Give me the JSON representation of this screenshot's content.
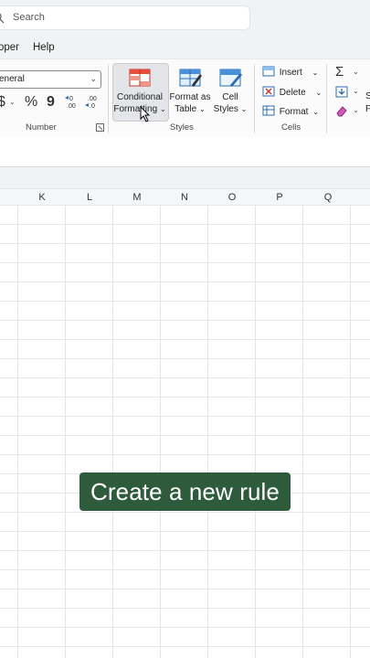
{
  "search": {
    "placeholder": "Search"
  },
  "menu": {
    "tabs": [
      "oper",
      "Help"
    ]
  },
  "number_group": {
    "format_value": "eneral",
    "label": "Number",
    "currency_symbol": "$",
    "percent_symbol": "%",
    "comma_symbol": "9"
  },
  "styles_group": {
    "label": "Styles",
    "conditional_formatting": [
      "Conditional",
      "Formatting"
    ],
    "format_as_table": [
      "Format as",
      "Table"
    ],
    "cell_styles": [
      "Cell",
      "Styles"
    ]
  },
  "cells_group": {
    "label": "Cells",
    "insert": "Insert",
    "delete": "Delete",
    "format": "Format"
  },
  "editing_group": {
    "partial_labels": [
      "S",
      "F"
    ]
  },
  "columns": [
    "K",
    "L",
    "M",
    "N",
    "O",
    "P",
    "Q"
  ],
  "caption": "Create a new rule",
  "colors": {
    "caption_bg": "#2f5b3d",
    "ribbon_bg": "#fbfbfc"
  }
}
